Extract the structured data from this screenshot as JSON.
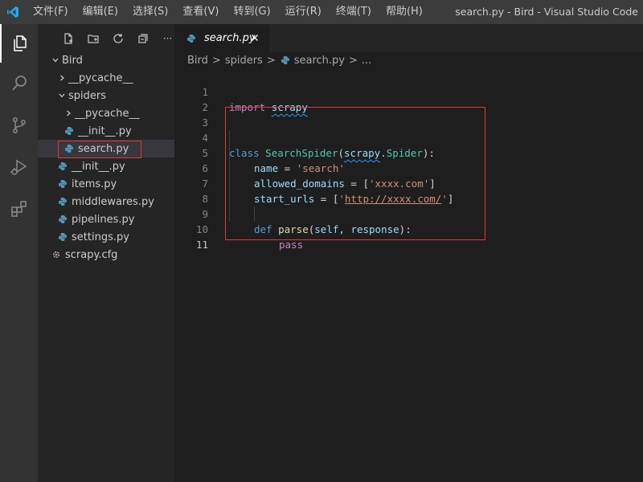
{
  "window": {
    "title": "search.py - Bird - Visual Studio Code",
    "menu": [
      "文件(F)",
      "编辑(E)",
      "选择(S)",
      "查看(V)",
      "转到(G)",
      "运行(R)",
      "终端(T)",
      "帮助(H)"
    ]
  },
  "activity_bar": {
    "icons": [
      "files-icon",
      "search-icon",
      "source-control-icon",
      "run-debug-icon",
      "extensions-icon"
    ],
    "active": "files-icon"
  },
  "explorer": {
    "toolbar_icons": [
      "new-file-icon",
      "new-folder-icon",
      "refresh-icon",
      "collapse-all-icon",
      "more-icon"
    ],
    "more_label": "···",
    "tree": [
      {
        "label": "Bird",
        "kind": "folder",
        "expanded": true
      },
      {
        "label": "__pycache__",
        "kind": "folder",
        "expanded": false
      },
      {
        "label": "spiders",
        "kind": "folder",
        "expanded": true
      },
      {
        "label": "__pycache__",
        "kind": "folder",
        "expanded": false
      },
      {
        "label": "__init__.py",
        "kind": "python"
      },
      {
        "label": "search.py",
        "kind": "python",
        "selected": true
      },
      {
        "label": "__init__.py",
        "kind": "python"
      },
      {
        "label": "items.py",
        "kind": "python"
      },
      {
        "label": "middlewares.py",
        "kind": "python"
      },
      {
        "label": "pipelines.py",
        "kind": "python"
      },
      {
        "label": "settings.py",
        "kind": "python"
      },
      {
        "label": "scrapy.cfg",
        "kind": "config"
      }
    ]
  },
  "tab": {
    "label": "search.py",
    "close": "×"
  },
  "breadcrumb": {
    "items": [
      "Bird",
      "spiders",
      "search.py",
      "..."
    ],
    "separator": ">"
  },
  "code": {
    "line_numbers": [
      "1",
      "2",
      "3",
      "4",
      "5",
      "6",
      "7",
      "8",
      "9",
      "10",
      "11"
    ],
    "l1": {
      "import": "import",
      "module": "scrapy"
    },
    "l4": {
      "class": "class",
      "name": "SearchSpider",
      "open": "(",
      "module": "scrapy",
      "dot": ".",
      "base": "Spider",
      "close": "):"
    },
    "l5": {
      "var": "name",
      "eq": " = ",
      "str": "'search'"
    },
    "l6": {
      "var": "allowed_domains",
      "eq": " = [",
      "str": "'xxxx.com'",
      "end": "]"
    },
    "l7": {
      "var": "start_urls",
      "eq": " = [",
      "q1": "'",
      "url": "http://xxxx.com/",
      "q2": "'",
      "end": "]"
    },
    "l9": {
      "def": "def",
      "fn": "parse",
      "open": "(",
      "p1": "self",
      "comma": ", ",
      "p2": "response",
      "close": "):"
    },
    "l10": {
      "kw": "pass"
    }
  },
  "colors": {
    "highlight_box": "#e03a3a",
    "vscode_blue": "#007acc",
    "python_icon": "#519aba"
  }
}
